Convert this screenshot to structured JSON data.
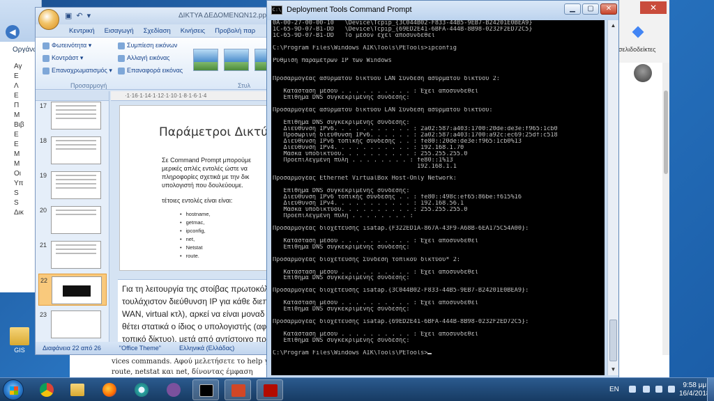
{
  "explorer": {
    "organize": "Οργάνω",
    "items": [
      "Αγ",
      "E",
      "Λ",
      "E",
      "Π",
      "M",
      "Βιβ",
      "E",
      "E",
      "M",
      "M",
      "Οι",
      "Υπ",
      "S",
      "S",
      "Δικ"
    ]
  },
  "desktop": {
    "icon_label": "GIS"
  },
  "powerpoint": {
    "doc_title": "ΔΙΚΤΥΑ ΔΕΔΟΜΕΝΩΝ12.pptx",
    "tabs": [
      "Κεντρική",
      "Εισαγωγή",
      "Σχεδίαση",
      "Κινήσεις",
      "Προβολή παρ"
    ],
    "ribbon_left": [
      "Φωτεινότητα",
      "Κοντράστ",
      "Επαναχρωματισμός"
    ],
    "ribbon_right": [
      "Συμπίεση εικόνων",
      "Αλλαγή εικόνας",
      "Επαναφορά εικόνας"
    ],
    "group_label": "Προσαρμογή",
    "group_label2": "Στυλ",
    "ruler": "·1·16·1·14·1·12·1·10·1·8·1·6·1·4",
    "thumb_numbers": [
      "17",
      "18",
      "19",
      "20",
      "21",
      "22",
      "23"
    ],
    "slide": {
      "title": "Παράμετροι Δικτύω",
      "bullet1": [
        "Σε Command Prompt μπορούμε",
        "μερικές απλές εντολές ώστε να",
        "πληροφορίες σχετικά με την δικ",
        "υπολογιστή που δουλεύουμε."
      ],
      "bullet2": "τέτοιες εντολές είναι είναι:",
      "commands": [
        "hostname,",
        "getmac,",
        "ipconfig,",
        "net,",
        "Netstat",
        "route."
      ]
    },
    "notes": [
      "Για τη λειτουργία της στοίβας πρωτοκόλ",
      "τουλάχιστον διεύθυνση IP για κάθε διεπ",
      "WAN, virtual κτλ), αρκεί να είναι μοναδ",
      "θέτει στατικά ο ίδιος ο υπολογιστής (αφ",
      "τοπικό δίκτυο), μετά από αντίστοιχο πρ"
    ],
    "status": [
      "Διαφάνεια 22 από 26",
      "\"Office Theme\"",
      "Ελληνικά (Ελλάδας)"
    ]
  },
  "underdoc": [
    "vices commands. Αφού μελετήσετε το help γ",
    "route, netstat και net, δίνοντας έμφαση"
  ],
  "browser": {
    "bookmarks": "σελιδοδείκτες"
  },
  "cmd": {
    "title": "Deployment Tools Command Prompt",
    "icon_text": "C:\\",
    "lines": [
      "0A-00-27-00-00-10   \\Device\\Tcpip_{3C044B02-F833-44B5-9EB7-B24201E0BEA9}",
      "1C-65-9D-07-B1-DD   \\Device\\Tcpip_{69ED2E41-6BFA-444B-8B98-0232F2ED72C5}",
      "1C-65-9D-07-B1-DD   Το μέσον έχει αποσυνδεθεί",
      "",
      "C:\\Program Files\\Windows AIK\\Tools\\PETools>ipconfig",
      "",
      "Ρύθμιση παραμέτρων IP των Windows",
      "",
      "",
      "Προσαρμογέας ασύρματου δικτύου LAN Σύνδεση ασύρματου δικτύου 2:",
      "",
      "   Κατάσταση μέσου . . . . . . . . . . : Έχει αποσυνδεθεί",
      "   Επίθημα DNS συγκεκριμένης σύνδεσης:",
      "",
      "Προσαρμογέας ασύρματου δικτύου LAN Σύνδεση ασύρματου δικτύου:",
      "",
      "   Επίθημα DNS συγκεκριμένης σύνδεσης:",
      "   Διεύθυνση IPv6. . . . . . . . . . . : 2a02:587:a403:1700:20de:de3e:f965:1cb0",
      "   Προσωρινή διεύθυνση IPv6. . . . . . : 2a02:587:a403:1700:a92c:ec69:25df:c518",
      "   Διεύθυνση IPv6 τοπικής σύνδεσης . . : fe80::20de:de3e:f965:1cb0%13",
      "   Διεύθυνση IPv4. . . . . . . . . . . : 192.168.1.70",
      "   Μάσκα υποδικτύου. . . . . . . . . . : 255.255.255.0",
      "   Προεπιλεγμένη πύλη . . . . . . . . : fe80::1%13",
      "                                        192.168.1.1",
      "",
      "Προσαρμογέας Ethernet VirtualBox Host-Only Network:",
      "",
      "   Επίθημα DNS συγκεκριμένης σύνδεσης:",
      "   Διεύθυνση IPv6 τοπικής σύνδεσης . . : fe80::498c:ef65:86be:f615%16",
      "   Διεύθυνση IPv4. . . . . . . . . . . : 192.168.56.1",
      "   Μάσκα υποδικτύου. . . . . . . . . . : 255.255.255.0",
      "   Προεπιλεγμένη πύλη . . . . . . . . :",
      "",
      "Προσαρμογέας διοχέτευσης isatap.{F322ED1A-867A-43F9-A68B-6EA175C54A00}:",
      "",
      "   Κατάσταση μέσου . . . . . . . . . . : Έχει αποσυνδεθεί",
      "   Επίθημα DNS συγκεκριμένης σύνδεσης:",
      "",
      "Προσαρμογέας διοχέτευσης Σύνδεση τοπικού δικτύου* 2:",
      "",
      "   Κατάσταση μέσου . . . . . . . . . . : Έχει αποσυνδεθεί",
      "   Επίθημα DNS συγκεκριμένης σύνδεσης:",
      "",
      "Προσαρμογέας διοχέτευσης isatap.{3C044B02-F833-44B5-9EB7-B24201E0BEA9}:",
      "",
      "   Κατάσταση μέσου . . . . . . . . . . : Έχει αποσυνδεθεί",
      "   Επίθημα DNS συγκεκριμένης σύνδεσης:",
      "",
      "Προσαρμογέας διοχέτευσης isatap.{69ED2E41-6BFA-444B-8B98-0232F2ED72C5}:",
      "",
      "   Κατάσταση μέσου . . . . . . . . . . : Έχει αποσυνδεθεί",
      "   Επίθημα DNS συγκεκριμένης σύνδεσης:",
      "",
      "C:\\Program Files\\Windows AIK\\Tools\\PETools>"
    ]
  },
  "taskbar": {
    "apps": [
      "chrome-icon",
      "explorer-icon",
      "firefox-icon",
      "search-icon",
      "viber-icon",
      "cmd-icon",
      "powerpoint-icon",
      "pdf-icon"
    ],
    "language": "EN",
    "time": "9:58 μμ",
    "date": "16/4/2018"
  },
  "colors": {
    "console_bg": "#000000",
    "console_fg": "#c0c0c0",
    "taskbar": "#173b63"
  }
}
